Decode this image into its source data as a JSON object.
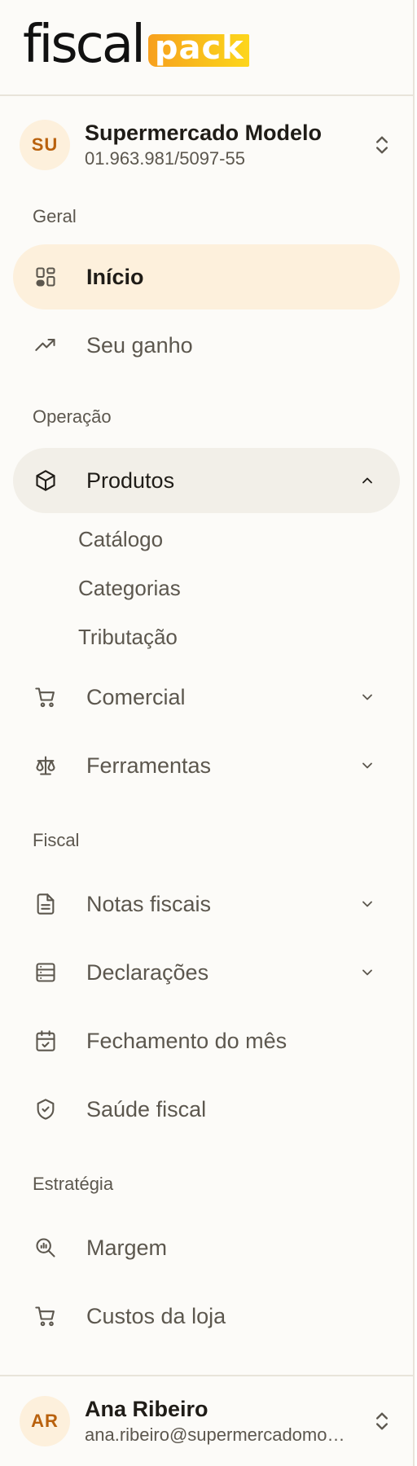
{
  "brand": {
    "name_part1": "fiscal",
    "name_part2": "pack"
  },
  "store": {
    "initials": "SU",
    "name": "Supermercado Modelo",
    "cnpj": "01.963.981/5097-55"
  },
  "sections": {
    "geral": "Geral",
    "operacao": "Operação",
    "fiscal": "Fiscal",
    "estrategia": "Estratégia"
  },
  "nav": {
    "inicio": "Início",
    "seu_ganho": "Seu ganho",
    "produtos": "Produtos",
    "produtos_sub": [
      "Catálogo",
      "Categorias",
      "Tributação"
    ],
    "comercial": "Comercial",
    "ferramentas": "Ferramentas",
    "notas_fiscais": "Notas fiscais",
    "declaracoes": "Declarações",
    "fechamento": "Fechamento do mês",
    "saude_fiscal": "Saúde fiscal",
    "margem": "Margem",
    "custos_loja": "Custos da loja"
  },
  "user": {
    "initials": "AR",
    "name": "Ana Ribeiro",
    "email": "ana.ribeiro@supermercadomodelo.com.br"
  },
  "colors": {
    "accent": "#f7a01e",
    "active_bg": "#fdf0dc",
    "open_bg": "#f2efe8",
    "avatar_text": "#b9610d"
  }
}
